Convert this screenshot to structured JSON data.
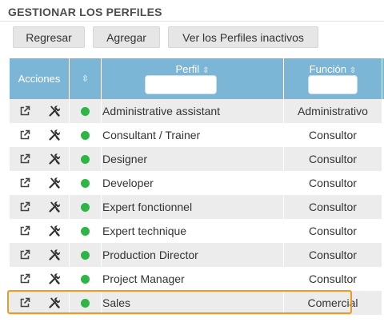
{
  "page": {
    "title": "GESTIONAR LOS PERFILES"
  },
  "toolbar": {
    "back_label": "Regresar",
    "add_label": "Agregar",
    "inactive_label": "Ver los Perfiles inactivos"
  },
  "table": {
    "headers": {
      "actions": "Acciones",
      "status_sort": "⇳",
      "profile": "Perfil",
      "function": "Función",
      "sort_icon": "⇳"
    },
    "filters": {
      "profile_value": "",
      "function_value": ""
    },
    "rows": [
      {
        "profile": "Administrative assistant",
        "function": "Administrativo",
        "status": "active"
      },
      {
        "profile": "Consultant / Trainer",
        "function": "Consultor",
        "status": "active"
      },
      {
        "profile": "Designer",
        "function": "Consultor",
        "status": "active"
      },
      {
        "profile": "Developer",
        "function": "Consultor",
        "status": "active"
      },
      {
        "profile": "Expert fonctionnel",
        "function": "Consultor",
        "status": "active"
      },
      {
        "profile": "Expert technique",
        "function": "Consultor",
        "status": "active"
      },
      {
        "profile": "Production Director",
        "function": "Consultor",
        "status": "active"
      },
      {
        "profile": "Project Manager",
        "function": "Consultor",
        "status": "active"
      },
      {
        "profile": "Sales",
        "function": "Comercial",
        "status": "active"
      }
    ]
  },
  "icons": {
    "open": "external-link-icon",
    "edit": "tools-icon",
    "status": "status-dot-icon",
    "sort": "sort-icon"
  },
  "colors": {
    "header_bg": "#7bb6d6",
    "status_active": "#2fb446",
    "highlight": "#f29a1f",
    "row_alt": "#ececec"
  },
  "highlighted_row": "Sales"
}
